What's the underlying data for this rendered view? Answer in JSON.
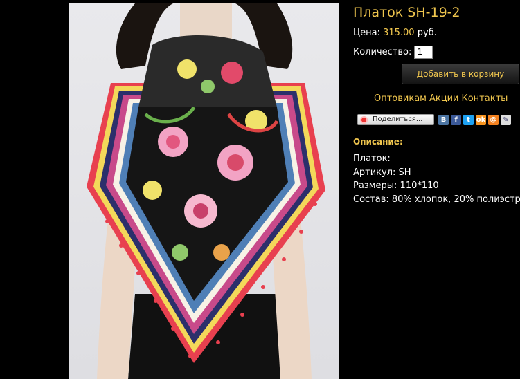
{
  "product": {
    "title": "Платок SH-19-2",
    "price_label": "Цена:",
    "price_value": "315.00",
    "price_currency": "руб.",
    "qty_label": "Количество:",
    "qty_value": "1",
    "add_to_cart": "Добавить в корзину"
  },
  "links": {
    "wholesale": "Оптовикам",
    "sales": "Акции",
    "contacts": "Контакты"
  },
  "share": {
    "button_label": "Поделиться...",
    "vk": "B",
    "fb": "f",
    "tw": "t",
    "ok": "ok",
    "mr": "@",
    "lj": "✎"
  },
  "description": {
    "heading": "Описание:",
    "lines": [
      "Платок:",
      "Артикул: SH",
      "Размеры: 110*110",
      "Состав: 80% хлопок, 20% полиэстр"
    ]
  },
  "colors": {
    "accent": "#f0c64e",
    "background": "#000000"
  }
}
